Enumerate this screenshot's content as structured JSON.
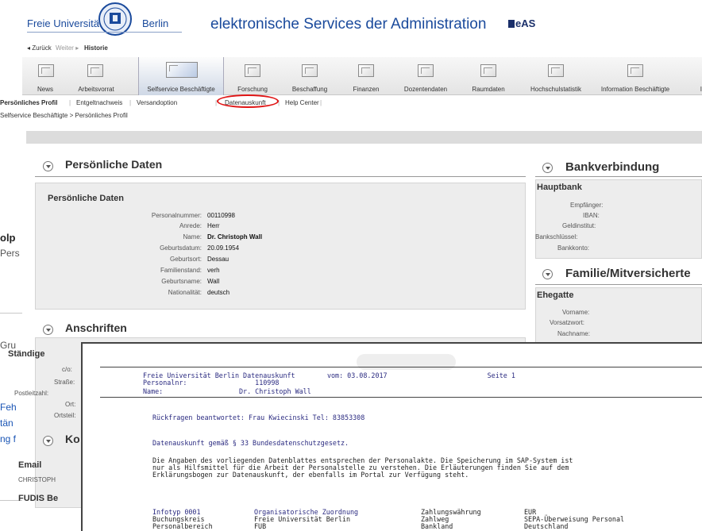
{
  "back_window": {
    "t1": "olp",
    "t2": "Pers",
    "t3": "Gru",
    "t4": "Feh",
    "t5": "tän",
    "t6": "ng f"
  },
  "header": {
    "fu_left": "Freie Universität",
    "fu_right": "Berlin",
    "title": "elektronische Services der Administration",
    "eas": "eAS"
  },
  "history": {
    "back": "◂ Zurück",
    "forward": "Weiter ▸",
    "history": "Historie"
  },
  "nav": [
    "News",
    "Arbeitsvorrat",
    "Selfservice Beschäftigte",
    "Forschung",
    "Beschaffung",
    "Finanzen",
    "Dozentendaten",
    "Raumdaten",
    "Hochschulstatistik",
    "Information Beschäftigte",
    "I"
  ],
  "subnav": [
    "Persönliches Profil",
    "Entgeltnachweis",
    "Versandoption",
    "Datenauskunft",
    "Help Center"
  ],
  "breadcrumb": "Selfservice Beschäftigte  >  Persönliches Profil",
  "personal": {
    "panel_title": "Persönliche Daten",
    "box_title": "Persönliche Daten",
    "rows": [
      {
        "k": "Personalnummer:",
        "v": "00110998"
      },
      {
        "k": "Anrede:",
        "v": "Herr"
      },
      {
        "k": "Name:",
        "v": "Dr. Christoph Wall"
      },
      {
        "k": "Geburtsdatum:",
        "v": "20.09.1954"
      },
      {
        "k": "Geburtsort:",
        "v": "Dessau"
      },
      {
        "k": "Familienstand:",
        "v": "verh"
      },
      {
        "k": "Geburtsname:",
        "v": "Wall"
      },
      {
        "k": "Nationalität:",
        "v": "deutsch"
      }
    ]
  },
  "anschriften": {
    "title": "Anschriften",
    "box_title": "Ständige",
    "labels": [
      "c/o:",
      "Straße:",
      "Postleitzahl:",
      "Ort:",
      "Ortsteil:"
    ]
  },
  "kontakt": {
    "title": "Ko",
    "email": "Email",
    "email_value": "CHRISTOPH",
    "fudis": "FUDIS Be"
  },
  "bank": {
    "title": "Bankverbindung",
    "box_title": "Hauptbank",
    "labels": [
      "Empfänger:",
      "IBAN:",
      "Geldinstitut:",
      "Bankschlüssel:",
      "Bankkonto:"
    ]
  },
  "familie": {
    "title": "Familie/Mitversicherte",
    "box_title": "Ehegatte",
    "labels": [
      "Vorname:",
      "Vorsatzwort:",
      "Nachname:"
    ]
  },
  "document": {
    "line1": "Freie Universität Berlin Datenauskunft        vom: 03.08.2017                         Seite 1",
    "line2": "Personalnr:                 110998",
    "line3": "Name:                   Dr. Christoph Wall",
    "rueckfragen": "Rückfragen beantwortet: Frau Kwiecinski Tel: 83853308",
    "datenauskunft": "Datenauskunft gemäß § 33 Bundesdatenschutzgesetz.",
    "p1": "Die Angaben des vorliegenden Datenblattes entsprechen der Personalakte. Die Speicherung im SAP-System ist",
    "p2": "nur als Hilfsmittel für die Arbeit der Personalstelle zu verstehen. Die Erläuterungen finden Sie auf dem",
    "p3": "Erklärungsbogen zur Datenauskunft, der ebenfalls im Portal zur Verfügung steht.",
    "table": [
      [
        "Infotyp 0001",
        "Organisatorische Zuordnung",
        "Zahlungswährung",
        "EUR"
      ],
      [
        "Buchungskreis",
        "Freie Universität Berlin",
        "Zahlweg",
        "SEPA-Überweisung Personal"
      ],
      [
        "Personalbereich",
        "FUB",
        "Bankland",
        "Deutschland"
      ]
    ]
  }
}
